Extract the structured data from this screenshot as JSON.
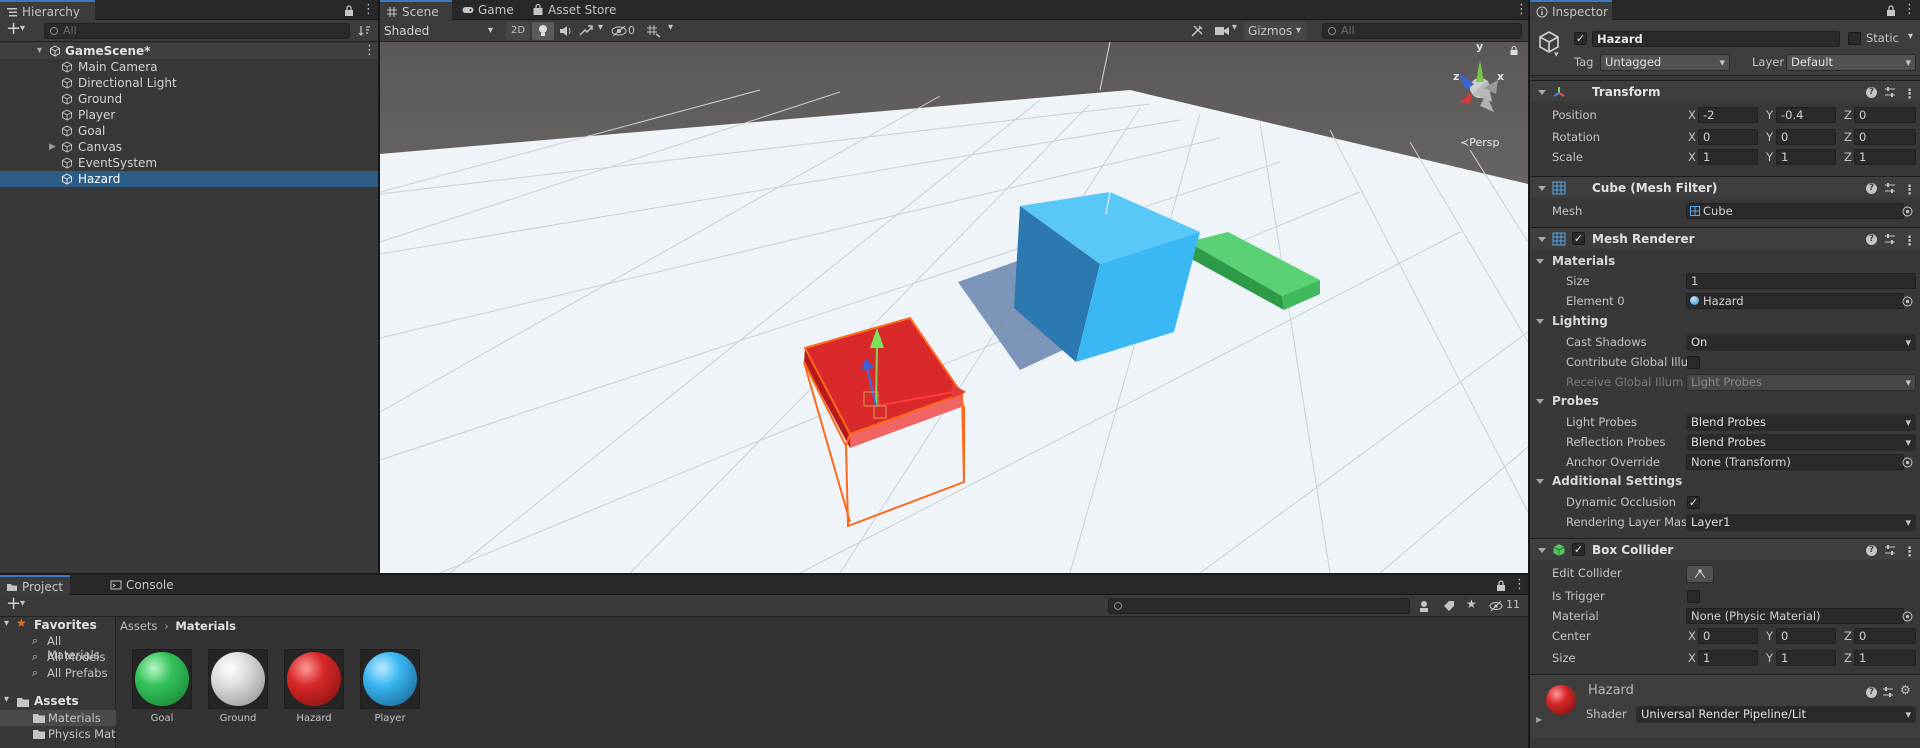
{
  "hierarchy": {
    "tab_label": "Hierarchy",
    "add_label": "+",
    "search_placeholder": "All",
    "scene_name": "GameScene*",
    "items": [
      {
        "label": "Main Camera"
      },
      {
        "label": "Directional Light"
      },
      {
        "label": "Ground"
      },
      {
        "label": "Player"
      },
      {
        "label": "Goal"
      },
      {
        "label": "Canvas"
      },
      {
        "label": "EventSystem"
      },
      {
        "label": "Hazard"
      }
    ]
  },
  "scene": {
    "tabs": [
      "Scene",
      "Game",
      "Asset Store"
    ],
    "shading_mode": "Shaded",
    "mode_2d": "2D",
    "fx_count": "0",
    "gizmos_label": "Gizmos",
    "search_placeholder": "All",
    "persp_label": "Persp",
    "axis_labels": {
      "x": "x",
      "y": "y",
      "z": "z"
    }
  },
  "project": {
    "tabs": [
      "Project",
      "Console"
    ],
    "add_label": "+",
    "hidden_count": "11",
    "favorites_label": "Favorites",
    "favorites": [
      "All Materials",
      "All Models",
      "All Prefabs"
    ],
    "assets_label": "Assets",
    "asset_folders": [
      "Materials",
      "Physics Mat"
    ],
    "breadcrumb": [
      "Assets",
      "Materials"
    ],
    "materials": [
      {
        "name": "Goal",
        "color": "#34c35a"
      },
      {
        "name": "Ground",
        "color": "#e4e4e4"
      },
      {
        "name": "Hazard",
        "color": "#d82828"
      },
      {
        "name": "Player",
        "color": "#39b6f2"
      }
    ]
  },
  "inspector": {
    "tab_label": "Inspector",
    "object_name": "Hazard",
    "static_label": "Static",
    "tag_label": "Tag",
    "tag_value": "Untagged",
    "layer_label": "Layer",
    "layer_value": "Default",
    "transform": {
      "title": "Transform",
      "position_label": "Position",
      "rotation_label": "Rotation",
      "scale_label": "Scale",
      "position": {
        "x": "-2",
        "y": "-0.4",
        "z": "0"
      },
      "rotation": {
        "x": "0",
        "y": "0",
        "z": "0"
      },
      "scale": {
        "x": "1",
        "y": "1",
        "z": "1"
      }
    },
    "mesh_filter": {
      "title": "Cube (Mesh Filter)",
      "mesh_label": "Mesh",
      "mesh_value": "Cube"
    },
    "mesh_renderer": {
      "title": "Mesh Renderer",
      "materials_label": "Materials",
      "size_label": "Size",
      "size_value": "1",
      "element0_label": "Element 0",
      "element0_value": "Hazard",
      "lighting_label": "Lighting",
      "cast_shadows_label": "Cast Shadows",
      "cast_shadows_value": "On",
      "contribute_gi_label": "Contribute Global Illu",
      "receive_gi_label": "Receive Global Illum",
      "receive_gi_value": "Light Probes",
      "probes_label": "Probes",
      "light_probes_label": "Light Probes",
      "light_probes_value": "Blend Probes",
      "reflection_probes_label": "Reflection Probes",
      "reflection_probes_value": "Blend Probes",
      "anchor_override_label": "Anchor Override",
      "anchor_override_value": "None (Transform)",
      "additional_label": "Additional Settings",
      "dynamic_occlusion_label": "Dynamic Occlusion",
      "rendering_layer_label": "Rendering Layer Mas",
      "rendering_layer_value": "Layer1"
    },
    "box_collider": {
      "title": "Box Collider",
      "edit_collider_label": "Edit Collider",
      "is_trigger_label": "Is Trigger",
      "material_label": "Material",
      "material_value": "None (Physic Material)",
      "center_label": "Center",
      "size_label": "Size",
      "center": {
        "x": "0",
        "y": "0",
        "z": "0"
      },
      "size": {
        "x": "1",
        "y": "1",
        "z": "1"
      }
    },
    "material": {
      "name": "Hazard",
      "shader_label": "Shader",
      "shader_value": "Universal Render Pipeline/Lit"
    },
    "axis": {
      "x": "X",
      "y": "Y",
      "z": "Z"
    }
  },
  "colors": {
    "selection": "#2c5d87",
    "accent": "#3a79bb",
    "hazard_red": "#d82828",
    "player_blue": "#39b6f2",
    "goal_green": "#34c35a"
  }
}
